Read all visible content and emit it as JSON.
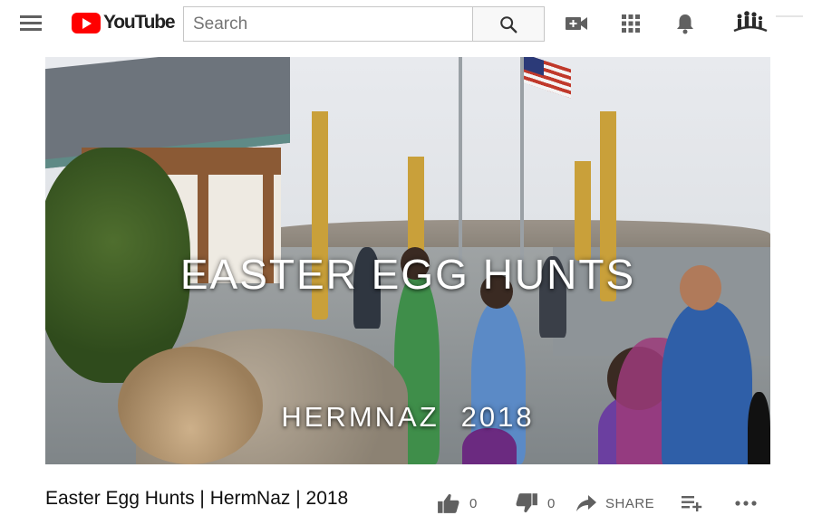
{
  "header": {
    "logo_text": "YouTube",
    "search": {
      "placeholder": "Search",
      "value": ""
    },
    "icons": [
      "menu-icon",
      "search-icon",
      "video-camera-add-icon",
      "apps-grid-icon",
      "notifications-bell-icon",
      "channel-avatar"
    ]
  },
  "video": {
    "overlay_title": "EASTER EGG HUNTS",
    "overlay_subtitle_left": "HERMNAZ",
    "overlay_subtitle_right": "2018",
    "title": "Easter Egg Hunts | HermNaz | 2018"
  },
  "actions": {
    "like_count": "0",
    "dislike_count": "0",
    "share_label": "SHARE",
    "icons": [
      "thumbs-up-icon",
      "thumbs-down-icon",
      "share-arrow-icon",
      "add-to-playlist-icon",
      "more-options-icon"
    ]
  },
  "colors": {
    "brand_red": "#ff0000",
    "icon_gray": "#606060",
    "text": "#0f0f0f"
  }
}
